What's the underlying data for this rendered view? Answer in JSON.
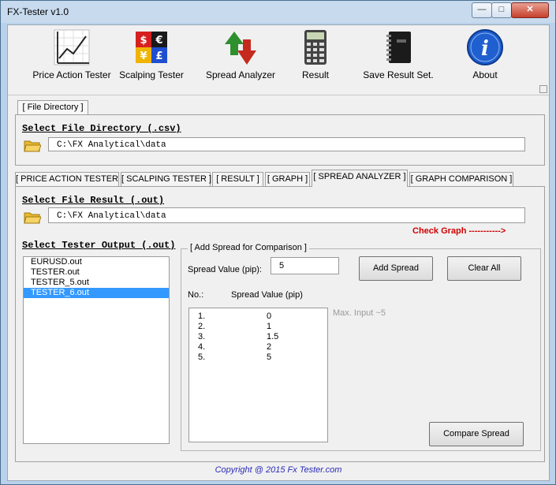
{
  "window": {
    "title": "FX-Tester v1.0"
  },
  "toolbar": {
    "items": [
      {
        "label": "Price Action Tester",
        "icon": "chart-icon"
      },
      {
        "label": "Scalping Tester",
        "icon": "currency-puzzle-icon"
      },
      {
        "label": "Spread Analyzer",
        "icon": "up-down-arrows-icon"
      },
      {
        "label": "Result",
        "icon": "calculator-icon"
      },
      {
        "label": "Save Result Set.",
        "icon": "notebook-icon"
      },
      {
        "label": "About",
        "icon": "info-icon"
      }
    ]
  },
  "file_directory": {
    "tab_label": "[ File Directory ]",
    "heading": "Select File Directory (.csv)",
    "path": "C:\\FX Analytical\\data"
  },
  "tabs": [
    {
      "label": "[ PRICE ACTION TESTER ]"
    },
    {
      "label": "[ SCALPING TESTER ]"
    },
    {
      "label": "[ RESULT ]"
    },
    {
      "label": "[ GRAPH ]"
    },
    {
      "label": "[ SPREAD ANALYZER ]",
      "active": true
    },
    {
      "label": "[ GRAPH COMPARISON ]"
    }
  ],
  "spread_analyzer": {
    "result_heading": "Select File Result (.out)",
    "result_path": "C:\\FX Analytical\\data",
    "check_graph": "Check Graph ----------->",
    "output_heading": "Select Tester Output (.out)",
    "output_files": [
      {
        "name": "EURUSD.out",
        "selected": false
      },
      {
        "name": "TESTER.out",
        "selected": false
      },
      {
        "name": "TESTER_5.out",
        "selected": false
      },
      {
        "name": "TESTER_6.out",
        "selected": true
      }
    ],
    "group_title": "[ Add Spread for Comparison ]",
    "spread_label": "Spread Value (pip):",
    "spread_value": "5",
    "add_button": "Add Spread",
    "clear_button": "Clear All",
    "col_no": "No.:",
    "col_value": "Spread Value (pip)",
    "spreads": [
      {
        "no": "1.",
        "value": "0"
      },
      {
        "no": "2.",
        "value": "1"
      },
      {
        "no": "3.",
        "value": "1.5"
      },
      {
        "no": "4.",
        "value": "2"
      },
      {
        "no": "5.",
        "value": "5"
      }
    ],
    "max_hint": "Max. Input ~5",
    "compare_button": "Compare Spread"
  },
  "footer": "Copyright @ 2015 Fx Tester.com"
}
